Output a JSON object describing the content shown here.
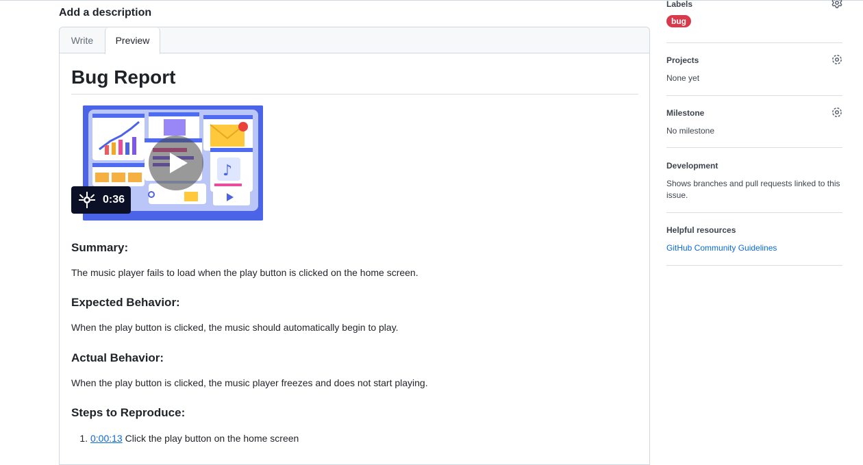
{
  "description": {
    "title": "Add a description",
    "tabs": {
      "write": "Write",
      "preview": "Preview"
    }
  },
  "preview": {
    "heading": "Bug Report",
    "video": {
      "duration": "0:36"
    },
    "summary": {
      "heading": "Summary:",
      "text": "The music player fails to load when the play button is clicked on the home screen."
    },
    "expected": {
      "heading": "Expected Behavior:",
      "text": "When the play button is clicked, the music should automatically begin to play."
    },
    "actual": {
      "heading": "Actual Behavior:",
      "text": "When the play button is clicked, the music player freezes and does not start playing."
    },
    "steps": {
      "heading": "Steps to Reproduce:",
      "items": [
        {
          "timestamp": "0:00:13",
          "text": "Click the play button on the home screen"
        }
      ]
    }
  },
  "sidebar": {
    "labels": {
      "title": "Labels",
      "items": [
        "bug"
      ]
    },
    "projects": {
      "title": "Projects",
      "value": "None yet"
    },
    "milestone": {
      "title": "Milestone",
      "value": "No milestone"
    },
    "development": {
      "title": "Development",
      "value": "Shows branches and pull requests linked to this issue."
    },
    "helpful": {
      "title": "Helpful resources",
      "link": "GitHub Community Guidelines"
    }
  },
  "colors": {
    "bug_label": "#d73a4a",
    "link": "#0969da",
    "border": "#d0d7de"
  },
  "icons": {
    "gear": "gear-icon",
    "play": "play-icon",
    "loom": "loom-icon"
  }
}
